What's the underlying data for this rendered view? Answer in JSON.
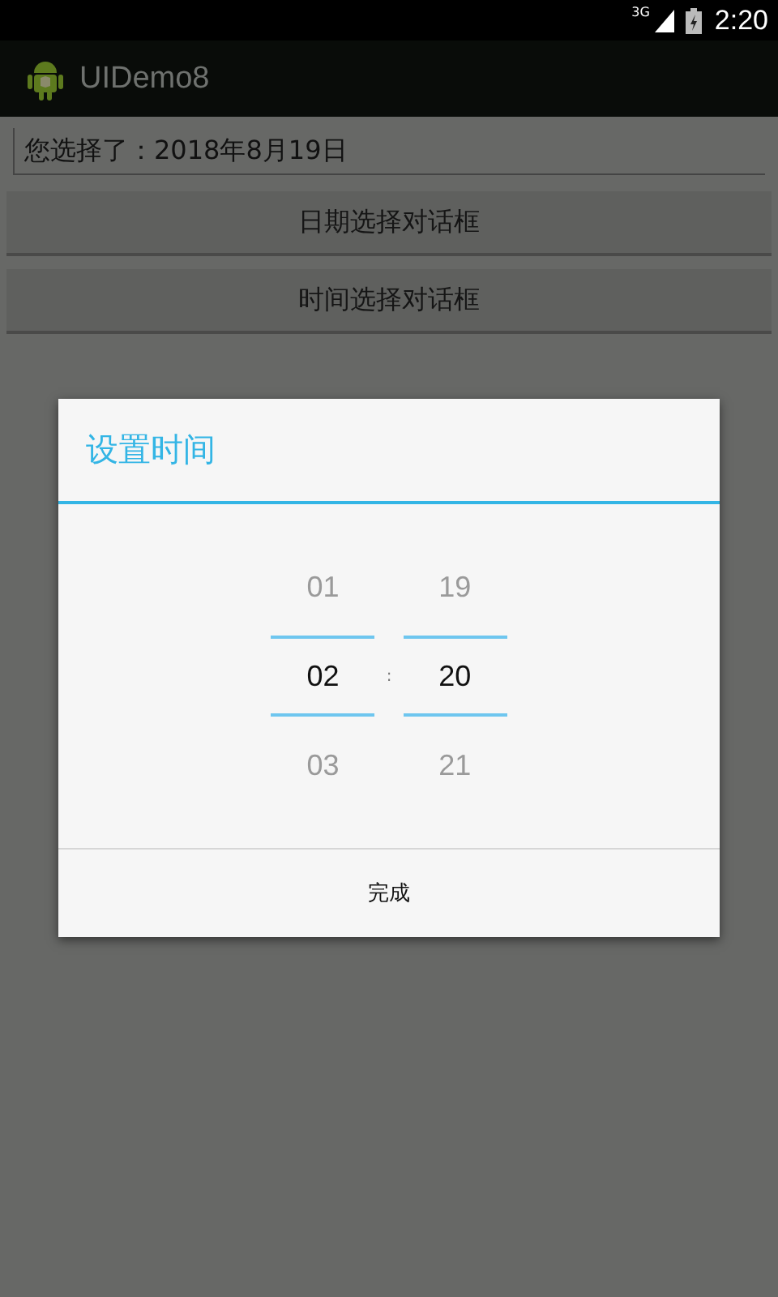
{
  "status_bar": {
    "network": "3G",
    "time": "2:20"
  },
  "action_bar": {
    "title": "UIDemo8"
  },
  "result_field": {
    "value": "您选择了：2018年8月19日"
  },
  "buttons": [
    "日期选择对话框",
    "时间选择对话框"
  ],
  "dialog": {
    "title": "设置时间",
    "separator": ":",
    "pickers": [
      {
        "items": [
          {
            "label": "01",
            "selected": false
          },
          {
            "label": "02",
            "selected": true
          },
          {
            "label": "03",
            "selected": false
          }
        ]
      },
      {
        "items": [
          {
            "label": "19",
            "selected": false
          },
          {
            "label": "20",
            "selected": true
          },
          {
            "label": "21",
            "selected": false
          }
        ]
      }
    ],
    "button": "完成"
  }
}
